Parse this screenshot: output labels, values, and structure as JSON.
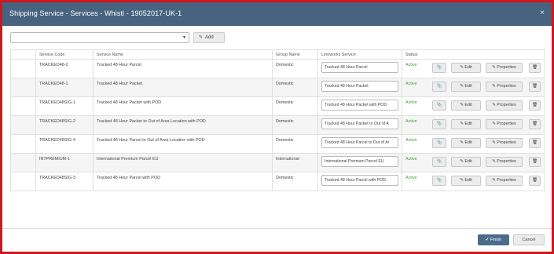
{
  "dialog": {
    "title": "Shipping Service - Services - Whistl - 19052017-UK-1",
    "close_glyph": "×"
  },
  "toolbar": {
    "select_value": "",
    "add_label": "Add"
  },
  "table": {
    "headers": [
      "",
      "Service Code",
      "Service Name",
      "Group Name",
      "Linnworks Service",
      "Status",
      ""
    ],
    "rows": [
      {
        "code": "TRACKED48-2",
        "name": "Tracked 48 Hour Parcel",
        "group": "Domestic",
        "linnworks": "Tracked 48 Hour Parcel",
        "status": "Active"
      },
      {
        "code": "TRACKED48-1",
        "name": "Tracked 48 Hour Packet",
        "group": "Domestic",
        "linnworks": "Tracked 48 Hour Packet",
        "status": "Active"
      },
      {
        "code": "TRACKED48SIG-1",
        "name": "Tracked 48 Hour Packet with POD",
        "group": "Domestic",
        "linnworks": "Tracked 48 Hour Packet with POD",
        "status": "Active"
      },
      {
        "code": "TRACKED48SIG-2",
        "name": "Tracked 48 Hour Packet to Out of Area Location with POD",
        "group": "Domestic",
        "linnworks": "Tracked 48 Hour Packet to Out of A",
        "status": "Active"
      },
      {
        "code": "TRACKED48SIG-4",
        "name": "Tracked 48 Hour Parcel to Out of Area Location with POD",
        "group": "Domestic",
        "linnworks": "Tracked 48 Hour Parcel to Out of Ar",
        "status": "Active"
      },
      {
        "code": "INTPREMIUM-1",
        "name": "International Premium Parcel EU",
        "group": "International",
        "linnworks": "International Premium Parcel EU",
        "status": "Active"
      },
      {
        "code": "TRACKED48SIG-3",
        "name": "Tracked 48 Hour Parcel with POD",
        "group": "Domestic",
        "linnworks": "Tracked 48 Hour Parcel with POD",
        "status": "Active"
      }
    ],
    "edit_label": "Edit",
    "properties_label": "Properties"
  },
  "footer": {
    "finish_label": "Finish",
    "cancel_label": "Cancel"
  },
  "colors": {
    "titlebar": "#47637f",
    "border": "#d0171c",
    "active": "#4a9a3a",
    "primary": "#4a6b8c"
  },
  "icons": {
    "close": "close-icon",
    "caret": "chevron-down-icon",
    "add": "pencil-icon",
    "link": "paperclip-icon",
    "edit": "pencil-icon",
    "properties": "pencil-icon",
    "delete": "trash-icon",
    "finish": "check-icon"
  }
}
